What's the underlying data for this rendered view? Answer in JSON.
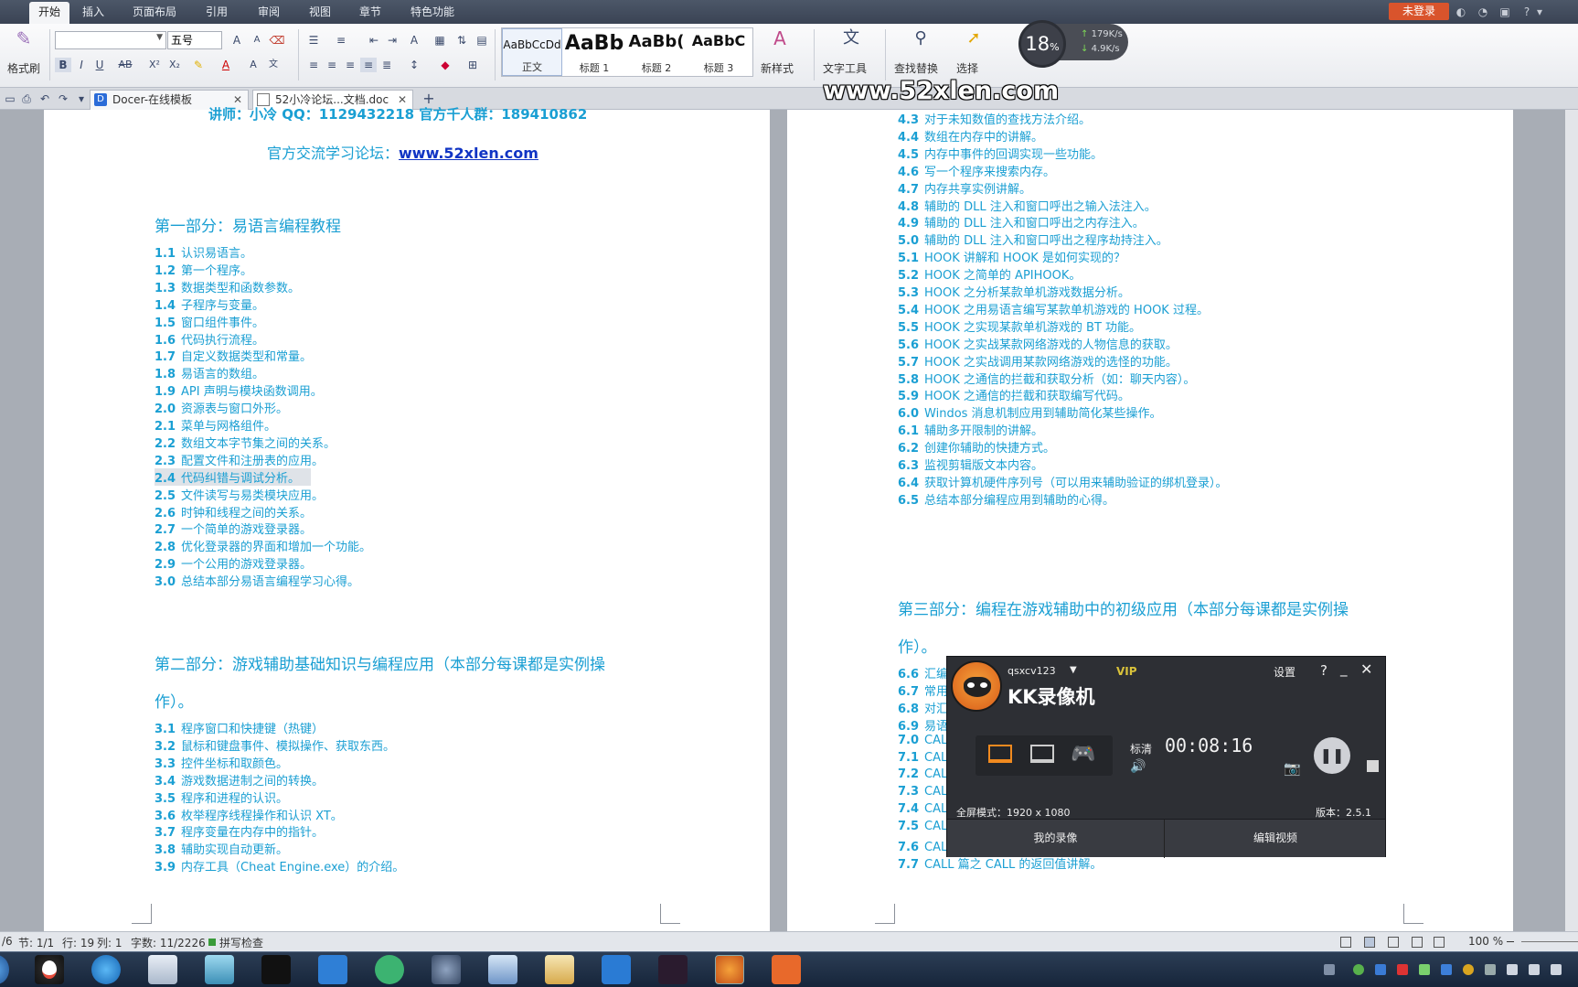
{
  "menubar": {
    "tabs": [
      "开始",
      "插入",
      "页面布局",
      "引用",
      "审阅",
      "视图",
      "章节",
      "特色功能"
    ],
    "active_tab": "开始",
    "login_label": "未登录"
  },
  "ribbon": {
    "format_painter_label": "格式刷",
    "font_size": "五号",
    "styles": [
      {
        "preview": "AaBbCcDd",
        "label": "正文"
      },
      {
        "preview": "AaBb",
        "label": "标题 1"
      },
      {
        "preview": "AaBb(",
        "label": "标题 2"
      },
      {
        "preview": "AaBbC",
        "label": "标题 3"
      }
    ],
    "new_style_label": "新样式",
    "text_tools_label": "文字工具",
    "find_replace_label": "查找替换",
    "select_label": "选择"
  },
  "speed_widget": {
    "percent": "18",
    "pct_sign": "%",
    "up": "179K/s",
    "down": "4.9K/s"
  },
  "watermark": "www.52xlen.com",
  "tabs": [
    {
      "label": "Docer-在线模板"
    },
    {
      "label": "52小冷论坛...文档.doc"
    }
  ],
  "left_page": {
    "partial_top": "讲师：小冷  QQ：1129432218  官方千人群：189410862",
    "forum_label": "官方交流学习论坛：",
    "forum_link": "www.52xlen.com",
    "part1_title": "第一部分：易语言编程教程",
    "part1_items": [
      {
        "n": "1.1",
        "t": "认识易语言。"
      },
      {
        "n": "1.2",
        "t": "第一个程序。"
      },
      {
        "n": "1.3",
        "t": "数据类型和函数参数。"
      },
      {
        "n": "1.4",
        "t": "子程序与变量。"
      },
      {
        "n": "1.5",
        "t": "窗口组件事件。"
      },
      {
        "n": "1.6",
        "t": "代码执行流程。"
      },
      {
        "n": "1.7",
        "t": "自定义数据类型和常量。"
      },
      {
        "n": "1.8",
        "t": "易语言的数组。"
      },
      {
        "n": "1.9",
        "t": "API 声明与模块函数调用。"
      },
      {
        "n": "2.0",
        "t": "资源表与窗口外形。"
      },
      {
        "n": "2.1",
        "t": "菜单与网格组件。"
      },
      {
        "n": "2.2",
        "t": "数组文本字节集之间的关系。"
      },
      {
        "n": "2.3",
        "t": "配置文件和注册表的应用。"
      },
      {
        "n": "2.4",
        "t": "代码纠错与调试分析。"
      },
      {
        "n": "2.5",
        "t": "文件读写与易类模块应用。"
      },
      {
        "n": "2.6",
        "t": "时钟和线程之间的关系。"
      },
      {
        "n": "2.7",
        "t": "一个简单的游戏登录器。"
      },
      {
        "n": "2.8",
        "t": "优化登录器的界面和增加一个功能。"
      },
      {
        "n": "2.9",
        "t": "一个公用的游戏登录器。"
      },
      {
        "n": "3.0",
        "t": "总结本部分易语言编程学习心得。"
      }
    ],
    "part2_title_line1": "第二部分：游戏辅助基础知识与编程应用（本部分每课都是实例操",
    "part2_title_line2": "作）。",
    "part2_items": [
      {
        "n": "3.1",
        "t": "程序窗口和快捷键（热键）"
      },
      {
        "n": "3.2",
        "t": "鼠标和键盘事件、模拟操作、获取东西。"
      },
      {
        "n": "3.3",
        "t": "控件坐标和取颜色。"
      },
      {
        "n": "3.4",
        "t": "游戏数据进制之间的转换。"
      },
      {
        "n": "3.5",
        "t": "程序和进程的认识。"
      },
      {
        "n": "3.6",
        "t": "枚举程序线程操作和认识 XT。"
      },
      {
        "n": "3.7",
        "t": "程序变量在内存中的指针。"
      },
      {
        "n": "3.8",
        "t": "辅助实现自动更新。"
      },
      {
        "n": "3.9",
        "t": "内存工具（Cheat Engine.exe）的介绍。"
      }
    ]
  },
  "right_page": {
    "items_top": [
      {
        "n": "4.3",
        "t": "对于未知数值的查找方法介绍。"
      },
      {
        "n": "4.4",
        "t": "数组在内存中的讲解。"
      },
      {
        "n": "4.5",
        "t": "内存中事件的回调实现一些功能。"
      },
      {
        "n": "4.6",
        "t": "写一个程序来搜索内存。"
      },
      {
        "n": "4.7",
        "t": "内存共享实例讲解。"
      },
      {
        "n": "4.8",
        "t": "辅助的 DLL 注入和窗口呼出之输入法注入。"
      },
      {
        "n": "4.9",
        "t": "辅助的 DLL 注入和窗口呼出之内存注入。"
      },
      {
        "n": "5.0",
        "t": "辅助的 DLL 注入和窗口呼出之程序劫持注入。"
      },
      {
        "n": "5.1",
        "t": "HOOK 讲解和 HOOK 是如何实现的？"
      },
      {
        "n": "5.2",
        "t": "HOOK 之简单的 APIHOOK。"
      },
      {
        "n": "5.3",
        "t": "HOOK 之分析某款单机游戏数据分析。"
      },
      {
        "n": "5.4",
        "t": "HOOK 之用易语言编写某款单机游戏的 HOOK 过程。"
      },
      {
        "n": "5.5",
        "t": "HOOK 之实现某款单机游戏的 BT 功能。"
      },
      {
        "n": "5.6",
        "t": "HOOK 之实战某款网络游戏的人物信息的获取。"
      },
      {
        "n": "5.7",
        "t": "HOOK 之实战调用某款网络游戏的选怪的功能。"
      },
      {
        "n": "5.8",
        "t": "HOOK 之通信的拦截和获取分析（如：聊天内容）。"
      },
      {
        "n": "5.9",
        "t": "HOOK 之通信的拦截和获取编写代码。"
      },
      {
        "n": "6.0",
        "t": "Windos 消息机制应用到辅助简化某些操作。"
      },
      {
        "n": "6.1",
        "t": "辅助多开限制的讲解。"
      },
      {
        "n": "6.2",
        "t": "创建你辅助的快捷方式。"
      },
      {
        "n": "6.3",
        "t": "监视剪辑版文本内容。"
      },
      {
        "n": "6.4",
        "t": "获取计算机硬件序列号（可以用来辅助验证的绑机登录）。"
      },
      {
        "n": "6.5",
        "t": "总结本部分编程应用到辅助的心得。"
      }
    ],
    "part3_title_line1": "第三部分：编程在游戏辅助中的初级应用（本部分每课都是实例操",
    "part3_title_line2": "作）。",
    "items_bottom": [
      {
        "n": "6.6",
        "t": "汇编"
      },
      {
        "n": "6.7",
        "t": "常用"
      },
      {
        "n": "6.8",
        "t": "对汇"
      },
      {
        "n": "6.9",
        "t": "易语"
      },
      {
        "n": "7.0",
        "t": "CALL"
      },
      {
        "n": "7.1",
        "t": "CALL"
      },
      {
        "n": "7.2",
        "t": "CALL"
      },
      {
        "n": "7.3",
        "t": "CALL"
      },
      {
        "n": "7.4",
        "t": "CALL"
      },
      {
        "n": "7.5",
        "t": "CALL"
      },
      {
        "n": "7.6",
        "t": "CALL 篇之 CALL 出错原因分析。"
      },
      {
        "n": "7.7",
        "t": "CALL 篇之 CALL 的返回值讲解。"
      }
    ]
  },
  "recorder": {
    "username": "qsxcv123",
    "vip": "VIP",
    "settings_label": "设置",
    "help_label": "?",
    "title": "KK录像机",
    "quality_label": "标清",
    "timer": "00:08:16",
    "mode_text": "全屏模式：1920 x 1080",
    "version_text": "版本：2.5.1",
    "my_recordings_label": "我的录像",
    "edit_video_label": "编辑视频"
  },
  "statusbar": {
    "page": "/6",
    "section": "节: 1/1",
    "row": "行: 19",
    "col": "列: 1",
    "words": "字数: 11/2226",
    "spell": "拼写检查",
    "zoom": "100 %"
  }
}
